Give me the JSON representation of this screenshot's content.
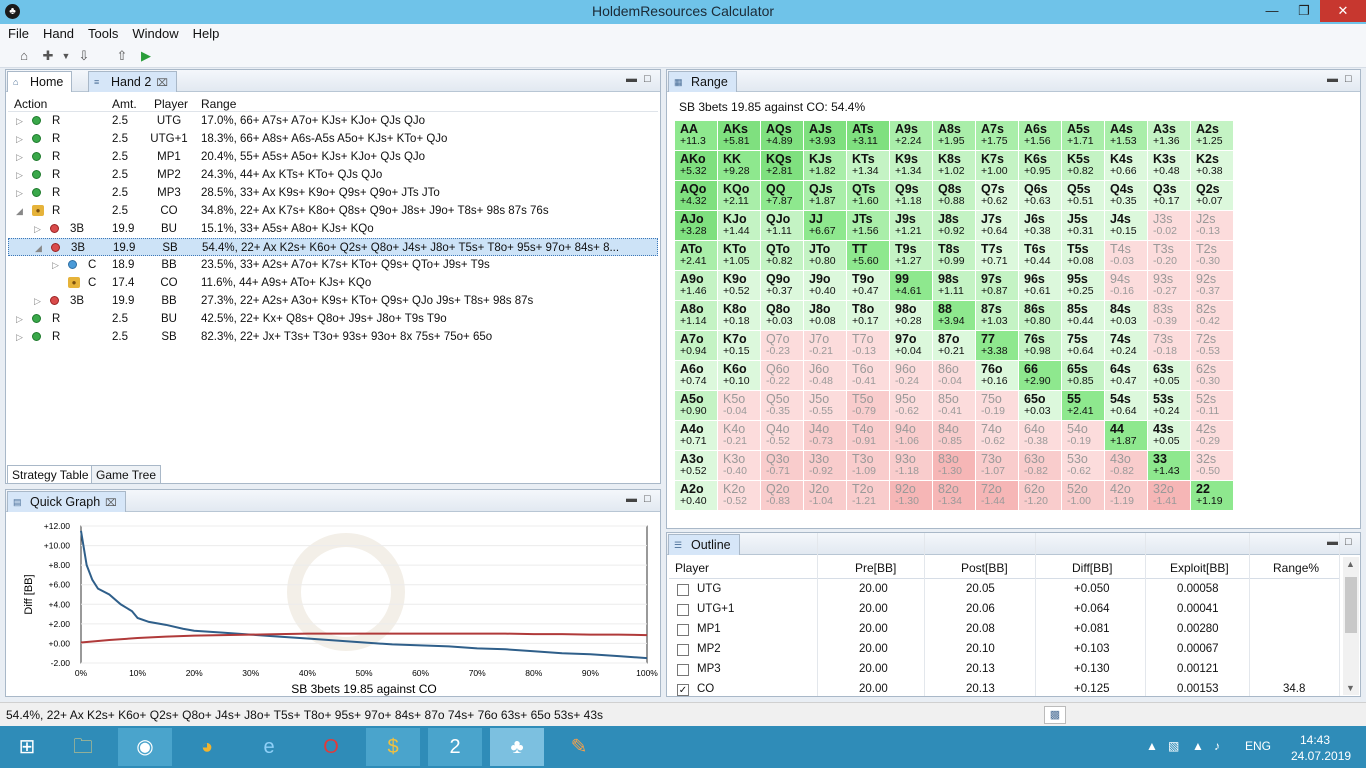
{
  "window": {
    "title": "HoldemResources Calculator"
  },
  "menu": [
    "File",
    "Hand",
    "Tools",
    "Window",
    "Help"
  ],
  "tabs": {
    "home": "Home",
    "hand2": "Hand 2"
  },
  "strategy": {
    "headers": {
      "action": "Action",
      "amt": "Amt.",
      "player": "Player",
      "range": "Range"
    },
    "rows": [
      {
        "a": "R",
        "amt": "2.5",
        "p": "UTG",
        "r": "17.0%, 66+ A7s+ A7o+ KJs+ KJo+ QJs QJo"
      },
      {
        "a": "R",
        "amt": "2.5",
        "p": "UTG+1",
        "r": "18.3%, 66+ A8s+ A6s-A5s A5o+ KJs+ KTo+ QJo"
      },
      {
        "a": "R",
        "amt": "2.5",
        "p": "MP1",
        "r": "20.4%, 55+ A5s+ A5o+ KJs+ KJo+ QJs QJo"
      },
      {
        "a": "R",
        "amt": "2.5",
        "p": "MP2",
        "r": "24.3%, 44+ Ax KTs+ KTo+ QJs QJo"
      },
      {
        "a": "R",
        "amt": "2.5",
        "p": "MP3",
        "r": "28.5%, 33+ Ax K9s+ K9o+ Q9s+ Q9o+ JTs JTo"
      },
      {
        "a": "R",
        "amt": "2.5",
        "p": "CO",
        "r": "34.8%, 22+ Ax K7s+ K8o+ Q8s+ Q9o+ J8s+ J9o+ T8s+ 98s 87s 76s"
      },
      {
        "a": "3B",
        "amt": "19.9",
        "p": "BU",
        "r": "15.1%, 33+ A5s+ A8o+ KJs+ KQo"
      },
      {
        "a": "3B",
        "amt": "19.9",
        "p": "SB",
        "r": "54.4%, 22+ Ax K2s+ K6o+ Q2s+ Q8o+ J4s+ J8o+ T5s+ T8o+ 95s+ 97o+ 84s+ 8..."
      },
      {
        "a": "C",
        "amt": "18.9",
        "p": "BB",
        "r": "23.5%, 33+ A2s+ A7o+ K7s+ KTo+ Q9s+ QTo+ J9s+ T9s"
      },
      {
        "a": "C",
        "amt": "17.4",
        "p": "CO",
        "r": "11.6%, 44+ A9s+ ATo+ KJs+ KQo"
      },
      {
        "a": "3B",
        "amt": "19.9",
        "p": "BB",
        "r": "27.3%, 22+ A2s+ A3o+ K9s+ KTo+ Q9s+ QJo J9s+ T8s+ 98s 87s"
      },
      {
        "a": "R",
        "amt": "2.5",
        "p": "BU",
        "r": "42.5%, 22+ Kx+ Q8s+ Q8o+ J9s+ J8o+ T9s T9o"
      },
      {
        "a": "R",
        "amt": "2.5",
        "p": "SB",
        "r": "82.3%, 22+ Jx+ T3s+ T3o+ 93s+ 93o+ 8x 75s+ 75o+ 65o"
      }
    ],
    "bottom_tabs": [
      "Strategy Table",
      "Game Tree"
    ]
  },
  "quick_graph": {
    "tab": "Quick Graph",
    "xlabel": "SB 3bets 19.85 against CO",
    "ylabel": "Diff [BB]"
  },
  "chart_data": {
    "type": "line",
    "xlabel": "SB 3bets 19.85 against CO",
    "ylabel": "Diff [BB]",
    "xlim": [
      0,
      100
    ],
    "ylim": [
      -2,
      12
    ],
    "x_ticks": [
      "0%",
      "10%",
      "20%",
      "30%",
      "40%",
      "50%",
      "60%",
      "70%",
      "80%",
      "90%",
      "100%"
    ],
    "y_ticks": [
      "+12.00",
      "+10.00",
      "+8.00",
      "+6.00",
      "+4.00",
      "+2.00",
      "+0.00",
      "-2.00"
    ],
    "series": [
      {
        "color": "#2f5f8a",
        "x": [
          0,
          1,
          2,
          3,
          5,
          7,
          9,
          10,
          12,
          15,
          18,
          20,
          25,
          30,
          35,
          40,
          45,
          50,
          55,
          60,
          65,
          70,
          75,
          80,
          85,
          90,
          95,
          100
        ],
        "y": [
          11.5,
          8,
          6.5,
          5.6,
          5,
          4,
          3.3,
          2.6,
          2.2,
          1.9,
          1.5,
          1.3,
          1.1,
          0.9,
          0.7,
          0.5,
          0.3,
          0.1,
          -0.1,
          -0.2,
          -0.3,
          -0.5,
          -0.6,
          -0.8,
          -1.0,
          -1.1,
          -1.3,
          -1.5
        ]
      },
      {
        "color": "#b03a3a",
        "x": [
          0,
          5,
          10,
          15,
          20,
          25,
          30,
          35,
          40,
          45,
          50,
          55,
          60,
          65,
          70,
          75,
          80,
          85,
          90,
          95,
          100
        ],
        "y": [
          0.1,
          0.35,
          0.55,
          0.7,
          0.8,
          0.85,
          0.9,
          0.95,
          1.0,
          1.0,
          1.0,
          1.0,
          1.0,
          1.0,
          1.0,
          1.0,
          0.95,
          0.95,
          0.9,
          0.9,
          0.85
        ]
      }
    ]
  },
  "range": {
    "tab": "Range",
    "title": "SB 3bets 19.85 against CO: 54.4%",
    "cells": [
      [
        "AA",
        "+11.3",
        "AKs",
        "+5.81",
        "AQs",
        "+4.89",
        "AJs",
        "+3.93",
        "ATs",
        "+3.11",
        "A9s",
        "+2.24",
        "A8s",
        "+1.95",
        "A7s",
        "+1.75",
        "A6s",
        "+1.56",
        "A5s",
        "+1.71",
        "A4s",
        "+1.53",
        "A3s",
        "+1.36",
        "A2s",
        "+1.25"
      ],
      [
        "AKo",
        "+5.32",
        "KK",
        "+9.28",
        "KQs",
        "+2.81",
        "KJs",
        "+1.82",
        "KTs",
        "+1.34",
        "K9s",
        "+1.34",
        "K8s",
        "+1.02",
        "K7s",
        "+1.00",
        "K6s",
        "+0.95",
        "K5s",
        "+0.82",
        "K4s",
        "+0.66",
        "K3s",
        "+0.48",
        "K2s",
        "+0.38"
      ],
      [
        "AQo",
        "+4.32",
        "KQo",
        "+2.11",
        "QQ",
        "+7.87",
        "QJs",
        "+1.87",
        "QTs",
        "+1.60",
        "Q9s",
        "+1.18",
        "Q8s",
        "+0.88",
        "Q7s",
        "+0.62",
        "Q6s",
        "+0.63",
        "Q5s",
        "+0.51",
        "Q4s",
        "+0.35",
        "Q3s",
        "+0.17",
        "Q2s",
        "+0.07"
      ],
      [
        "AJo",
        "+3.28",
        "KJo",
        "+1.44",
        "QJo",
        "+1.11",
        "JJ",
        "+6.67",
        "JTs",
        "+1.56",
        "J9s",
        "+1.21",
        "J8s",
        "+0.92",
        "J7s",
        "+0.64",
        "J6s",
        "+0.38",
        "J5s",
        "+0.31",
        "J4s",
        "+0.15",
        "J3s",
        "-0.02",
        "J2s",
        "-0.13"
      ],
      [
        "ATo",
        "+2.41",
        "KTo",
        "+1.05",
        "QTo",
        "+0.82",
        "JTo",
        "+0.80",
        "TT",
        "+5.60",
        "T9s",
        "+1.27",
        "T8s",
        "+0.99",
        "T7s",
        "+0.71",
        "T6s",
        "+0.44",
        "T5s",
        "+0.08",
        "T4s",
        "-0.03",
        "T3s",
        "-0.20",
        "T2s",
        "-0.30"
      ],
      [
        "A9o",
        "+1.46",
        "K9o",
        "+0.52",
        "Q9o",
        "+0.37",
        "J9o",
        "+0.40",
        "T9o",
        "+0.47",
        "99",
        "+4.61",
        "98s",
        "+1.11",
        "97s",
        "+0.87",
        "96s",
        "+0.61",
        "95s",
        "+0.25",
        "94s",
        "-0.16",
        "93s",
        "-0.27",
        "92s",
        "-0.37"
      ],
      [
        "A8o",
        "+1.14",
        "K8o",
        "+0.18",
        "Q8o",
        "+0.03",
        "J8o",
        "+0.08",
        "T8o",
        "+0.17",
        "98o",
        "+0.28",
        "88",
        "+3.94",
        "87s",
        "+1.03",
        "86s",
        "+0.80",
        "85s",
        "+0.44",
        "84s",
        "+0.03",
        "83s",
        "-0.39",
        "82s",
        "-0.42"
      ],
      [
        "A7o",
        "+0.94",
        "K7o",
        "+0.15",
        "Q7o",
        "-0.23",
        "J7o",
        "-0.21",
        "T7o",
        "-0.13",
        "97o",
        "+0.04",
        "87o",
        "+0.21",
        "77",
        "+3.38",
        "76s",
        "+0.98",
        "75s",
        "+0.64",
        "74s",
        "+0.24",
        "73s",
        "-0.18",
        "72s",
        "-0.53"
      ],
      [
        "A6o",
        "+0.74",
        "K6o",
        "+0.10",
        "Q6o",
        "-0.22",
        "J6o",
        "-0.48",
        "T6o",
        "-0.41",
        "96o",
        "-0.24",
        "86o",
        "-0.04",
        "76o",
        "+0.16",
        "66",
        "+2.90",
        "65s",
        "+0.85",
        "64s",
        "+0.47",
        "63s",
        "+0.05",
        "62s",
        "-0.30"
      ],
      [
        "A5o",
        "+0.90",
        "K5o",
        "-0.04",
        "Q5o",
        "-0.35",
        "J5o",
        "-0.55",
        "T5o",
        "-0.79",
        "95o",
        "-0.62",
        "85o",
        "-0.41",
        "75o",
        "-0.19",
        "65o",
        "+0.03",
        "55",
        "+2.41",
        "54s",
        "+0.64",
        "53s",
        "+0.24",
        "52s",
        "-0.11"
      ],
      [
        "A4o",
        "+0.71",
        "K4o",
        "-0.21",
        "Q4o",
        "-0.52",
        "J4o",
        "-0.73",
        "T4o",
        "-0.91",
        "94o",
        "-1.06",
        "84o",
        "-0.85",
        "74o",
        "-0.62",
        "64o",
        "-0.38",
        "54o",
        "-0.19",
        "44",
        "+1.87",
        "43s",
        "+0.05",
        "42s",
        "-0.29"
      ],
      [
        "A3o",
        "+0.52",
        "K3o",
        "-0.40",
        "Q3o",
        "-0.71",
        "J3o",
        "-0.92",
        "T3o",
        "-1.09",
        "93o",
        "-1.18",
        "83o",
        "-1.30",
        "73o",
        "-1.07",
        "63o",
        "-0.82",
        "53o",
        "-0.62",
        "43o",
        "-0.82",
        "33",
        "+1.43",
        "32s",
        "-0.50"
      ],
      [
        "A2o",
        "+0.40",
        "K2o",
        "-0.52",
        "Q2o",
        "-0.83",
        "J2o",
        "-1.04",
        "T2o",
        "-1.21",
        "92o",
        "-1.30",
        "82o",
        "-1.34",
        "72o",
        "-1.44",
        "62o",
        "-1.20",
        "52o",
        "-1.00",
        "42o",
        "-1.19",
        "32o",
        "-1.41",
        "22",
        "+1.19"
      ]
    ]
  },
  "outline": {
    "tab": "Outline",
    "headers": {
      "player": "Player",
      "pre": "Pre[BB]",
      "post": "Post[BB]",
      "diff": "Diff[BB]",
      "exploit": "Exploit[BB]",
      "range": "Range%"
    },
    "rows": [
      {
        "p": "UTG",
        "pre": "20.00",
        "post": "20.05",
        "diff": "+0.050",
        "ex": "0.00058",
        "r": "",
        "c": false
      },
      {
        "p": "UTG+1",
        "pre": "20.00",
        "post": "20.06",
        "diff": "+0.064",
        "ex": "0.00041",
        "r": "",
        "c": false
      },
      {
        "p": "MP1",
        "pre": "20.00",
        "post": "20.08",
        "diff": "+0.081",
        "ex": "0.00280",
        "r": "",
        "c": false
      },
      {
        "p": "MP2",
        "pre": "20.00",
        "post": "20.10",
        "diff": "+0.103",
        "ex": "0.00067",
        "r": "",
        "c": false
      },
      {
        "p": "MP3",
        "pre": "20.00",
        "post": "20.13",
        "diff": "+0.130",
        "ex": "0.00121",
        "r": "",
        "c": false
      },
      {
        "p": "CO",
        "pre": "20.00",
        "post": "20.13",
        "diff": "+0.125",
        "ex": "0.00153",
        "r": "34.8",
        "c": true
      }
    ]
  },
  "status": {
    "text": "54.4%, 22+ Ax K2s+ K6o+ Q2s+ Q8o+ J4s+ J8o+ T5s+ T8o+ 95s+ 97o+ 84s+ 87o 74s+ 76o 63s+ 65o 53s+ 43s"
  },
  "tray": {
    "lang": "ENG",
    "time": "14:43",
    "date": "24.07.2019"
  }
}
